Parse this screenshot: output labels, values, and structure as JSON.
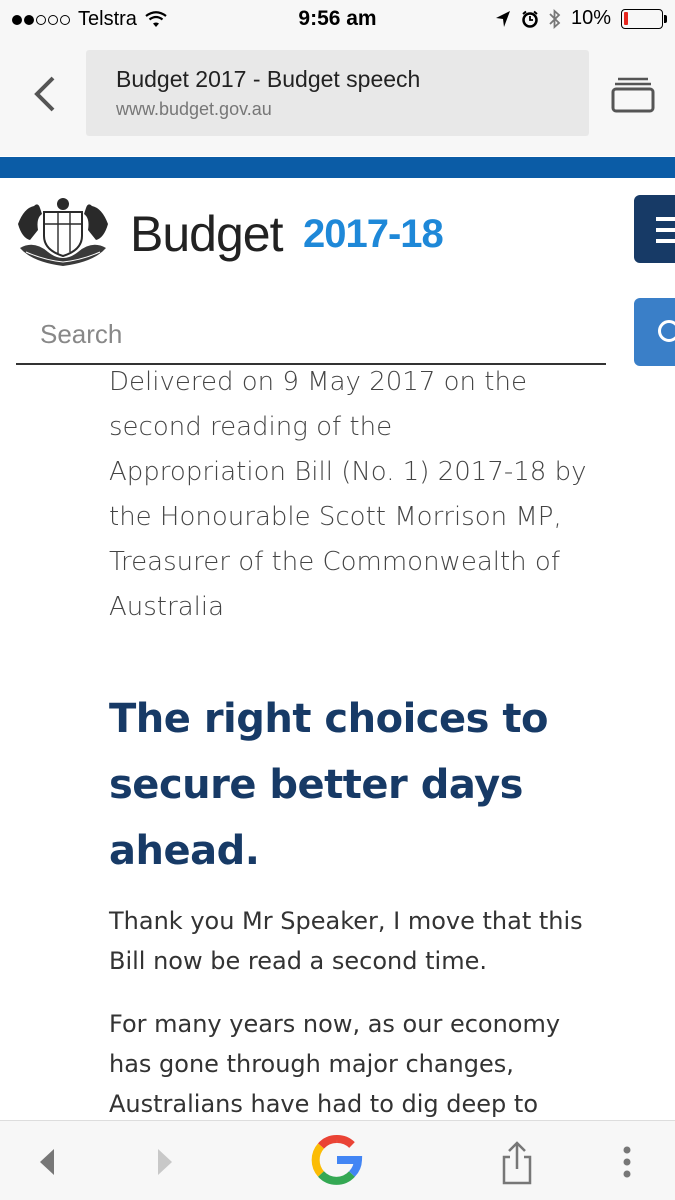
{
  "status_bar": {
    "carrier": "Telstra",
    "time": "9:56 am",
    "battery": "10%",
    "signal_icon": "signal-dots-icon",
    "wifi_icon": "wifi-icon",
    "location_icon": "location-arrow-icon",
    "alarm_icon": "alarm-icon",
    "bluetooth_icon": "bluetooth-icon",
    "battery_level": 0.1,
    "battery_color": "#e8271f"
  },
  "browser": {
    "tab_title": "Budget 2017 - Budget speech",
    "url": "www.budget.gov.au"
  },
  "site": {
    "brand_word": "Budget",
    "brand_year": "2017-18",
    "brand_color": "#1e88d8",
    "header_color": "#0b5ca6",
    "search_placeholder": "Search"
  },
  "article": {
    "intro_lines": [
      "Delivered on 9 May 2017 on the",
      "second reading of the",
      "Appropriation Bill (No. 1) 2017-18 by",
      "the Honourable Scott Morrison MP,",
      "Treasurer of the Commonwealth of",
      "Australia"
    ],
    "headline_lines": [
      "The right choices to",
      "secure better days",
      "ahead."
    ],
    "headline_color": "#173a66",
    "para1_lines": [
      "Thank you Mr Speaker, I move that this",
      "Bill now be read a second time."
    ],
    "para2_lines": [
      "For many years now, as our economy",
      "has gone through major changes,",
      "Australians have had to dig deep to"
    ]
  }
}
